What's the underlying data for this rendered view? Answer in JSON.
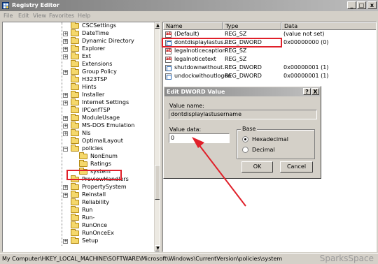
{
  "window": {
    "title": "Registry Editor",
    "minimize_glyph": "_",
    "maximize_glyph": "□",
    "close_glyph": "x"
  },
  "menu": [
    "File",
    "Edit",
    "View",
    "Favorites",
    "Help"
  ],
  "tree": {
    "items": [
      {
        "label": "CSCSettings",
        "expandable": false
      },
      {
        "label": "DateTime",
        "expandable": true
      },
      {
        "label": "Dynamic Directory",
        "expandable": true
      },
      {
        "label": "Explorer",
        "expandable": true
      },
      {
        "label": "Ext",
        "expandable": true
      },
      {
        "label": "Extensions",
        "expandable": false
      },
      {
        "label": "Group Policy",
        "expandable": true
      },
      {
        "label": "H323TSP",
        "expandable": false
      },
      {
        "label": "Hints",
        "expandable": false
      },
      {
        "label": "Installer",
        "expandable": true
      },
      {
        "label": "Internet Settings",
        "expandable": true
      },
      {
        "label": "IPConfTSP",
        "expandable": false
      },
      {
        "label": "ModuleUsage",
        "expandable": true
      },
      {
        "label": "MS-DOS Emulation",
        "expandable": true
      },
      {
        "label": "Nls",
        "expandable": true
      },
      {
        "label": "OptimalLayout",
        "expandable": false
      },
      {
        "label": "policies",
        "expandable": true
      },
      {
        "label": "NonEnum",
        "expandable": false
      },
      {
        "label": "Ratings",
        "expandable": false
      },
      {
        "label": "system",
        "expandable": false
      },
      {
        "label": "PreviewHandlers",
        "expandable": false
      },
      {
        "label": "PropertySystem",
        "expandable": true
      },
      {
        "label": "Reinstall",
        "expandable": true
      },
      {
        "label": "Reliability",
        "expandable": false
      },
      {
        "label": "Run",
        "expandable": false
      },
      {
        "label": "Run-",
        "expandable": false
      },
      {
        "label": "RunOnce",
        "expandable": false
      },
      {
        "label": "RunOnceEx",
        "expandable": false
      },
      {
        "label": "Setup",
        "expandable": true
      }
    ]
  },
  "list": {
    "headers": [
      "Name",
      "Type",
      "Data"
    ],
    "rows": [
      {
        "name": "(Default)",
        "type": "REG_SZ",
        "data": "(value not set)",
        "icon": "string-value-icon"
      },
      {
        "name": "dontdisplaylastus...",
        "type": "REG_DWORD",
        "data": "0x00000000 (0)",
        "icon": "dword-value-icon"
      },
      {
        "name": "legalnoticecaption",
        "type": "REG_SZ",
        "data": "",
        "icon": "string-value-icon"
      },
      {
        "name": "legalnoticetext",
        "type": "REG_SZ",
        "data": "",
        "icon": "string-value-icon"
      },
      {
        "name": "shutdownwithout...",
        "type": "REG_DWORD",
        "data": "0x00000001 (1)",
        "icon": "dword-value-icon"
      },
      {
        "name": "undockwithoutlogon",
        "type": "REG_DWORD",
        "data": "0x00000001 (1)",
        "icon": "dword-value-icon"
      }
    ]
  },
  "dialog": {
    "title": "Edit DWORD Value",
    "help_glyph": "?",
    "close_glyph": "X",
    "value_name_label": "Value name:",
    "value_name": "dontdisplaylastusername",
    "value_data_label": "Value data:",
    "value_data": "0",
    "base_label": "Base",
    "hex_label": "Hexadecimal",
    "dec_label": "Decimal",
    "ok_label": "OK",
    "cancel_label": "Cancel"
  },
  "status": {
    "path": "My Computer\\HKEY_LOCAL_MACHINE\\SOFTWARE\\Microsoft\\Windows\\CurrentVersion\\policies\\system"
  },
  "watermark": "SparksSpace",
  "colors": {
    "annotation": "#e0202a",
    "selection": "#316ac5"
  }
}
